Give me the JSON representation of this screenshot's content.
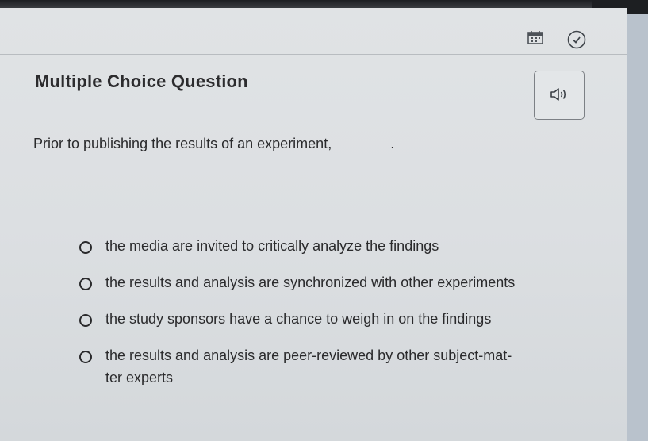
{
  "question": {
    "title": "Multiple Choice Question",
    "prompt": "Prior to publishing the results of an experiment,",
    "prompt_end": "."
  },
  "options": [
    {
      "label": "the media are invited to critically analyze the findings"
    },
    {
      "label": "the results and analysis are synchronized with other experiments"
    },
    {
      "label": "the study sponsors have a chance to weigh in on the findings"
    },
    {
      "label": "the results and analysis are peer-reviewed by other subject-mat-\nter experts"
    }
  ],
  "icons": {
    "calendar": "calendar-icon",
    "check": "check-circle-icon",
    "audio": "speaker-icon"
  },
  "colors": {
    "background": "#dcdfe2",
    "text": "#2a2a2c",
    "scrollbar": "#b9c2cc"
  }
}
